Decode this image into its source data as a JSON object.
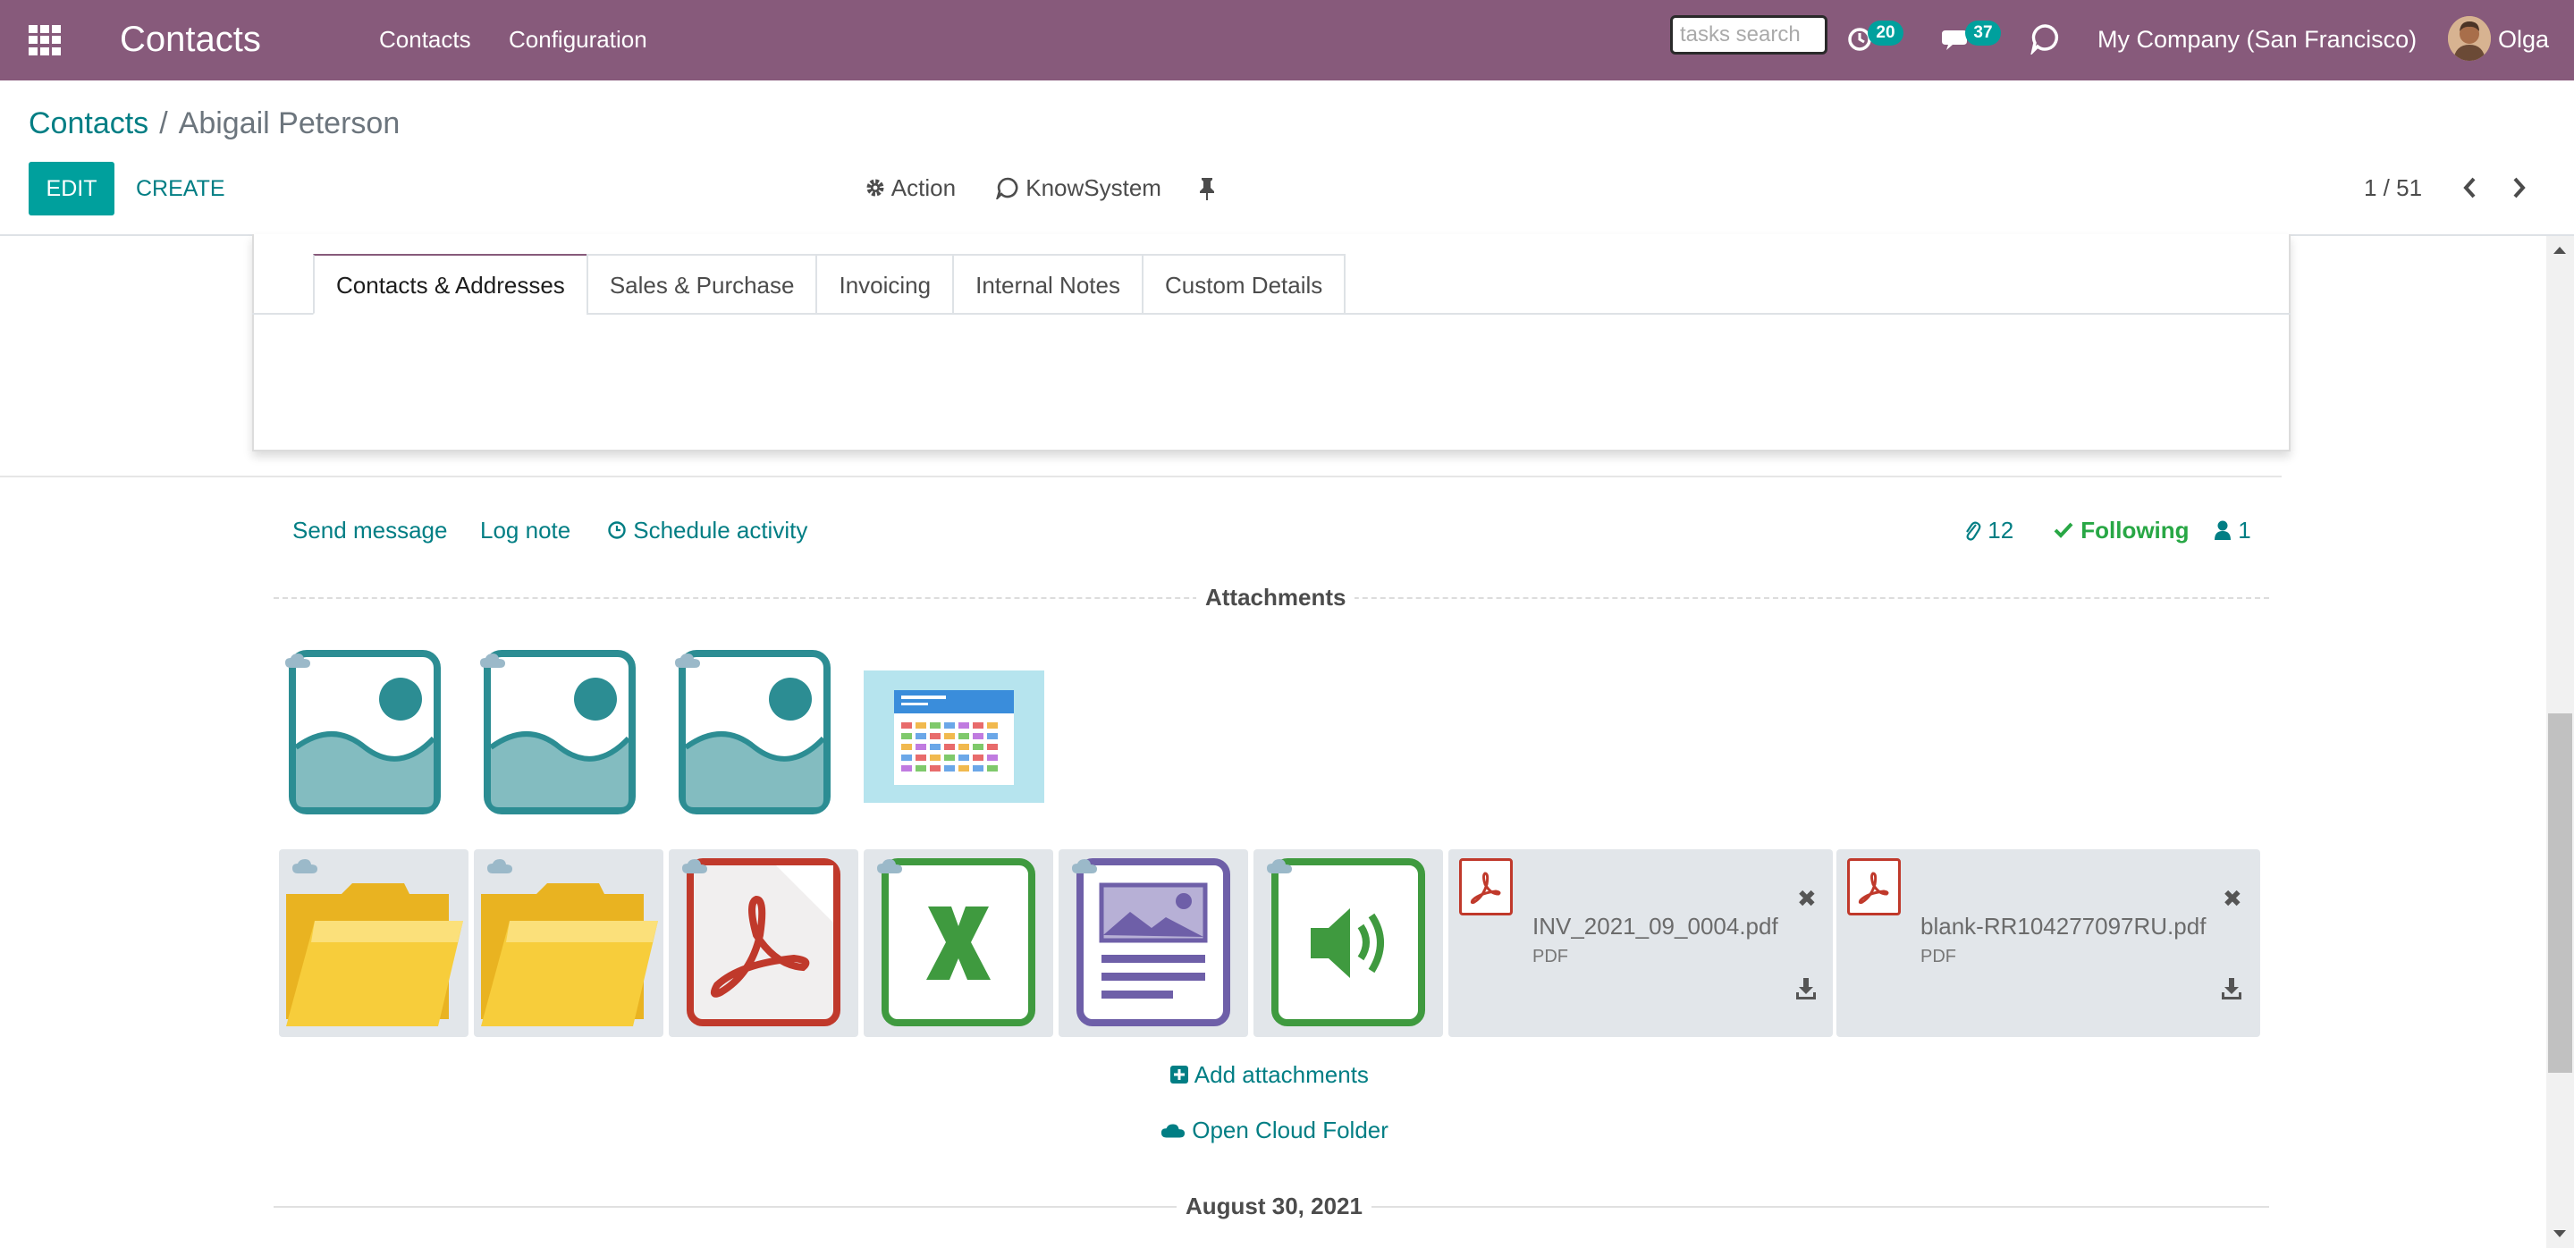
{
  "navbar": {
    "app_title": "Contacts",
    "menu": [
      "Contacts",
      "Configuration"
    ],
    "search_placeholder": "tasks search",
    "activity_count": "20",
    "message_count": "37",
    "company": "My Company (San Francisco)",
    "user": "Olga",
    "color": "#875a7b"
  },
  "control_panel": {
    "breadcrumb_parent": "Contacts",
    "breadcrumb_separator": "/",
    "breadcrumb_current": "Abigail Peterson",
    "edit_label": "EDIT",
    "create_label": "CREATE",
    "action_label": "Action",
    "knowsystem_label": "KnowSystem",
    "pager": "1 / 51"
  },
  "form": {
    "tabs": [
      "Contacts & Addresses",
      "Sales & Purchase",
      "Invoicing",
      "Internal Notes",
      "Custom Details"
    ],
    "active_tab": "Contacts & Addresses"
  },
  "chatter": {
    "send_message": "Send message",
    "log_note": "Log note",
    "schedule_activity": "Schedule activity",
    "attachment_count": "12",
    "following": "Following",
    "follower_count": "1",
    "attachments_title": "Attachments",
    "add_attachments": "Add attachments",
    "open_cloud_folder": "Open Cloud Folder",
    "date_separator": "August 30, 2021"
  },
  "attachments": {
    "images": [
      "image-placeholder-icon",
      "image-placeholder-icon",
      "image-placeholder-icon",
      "calendar-thumbnail"
    ],
    "tiles": [
      "folder-icon",
      "folder-icon",
      "pdf-icon",
      "spreadsheet-icon",
      "document-image-icon",
      "audio-icon"
    ],
    "files": [
      {
        "name": "INV_2021_09_0004.pdf",
        "type": "PDF"
      },
      {
        "name": "blank-RR104277097RU.pdf",
        "type": "PDF"
      }
    ]
  }
}
